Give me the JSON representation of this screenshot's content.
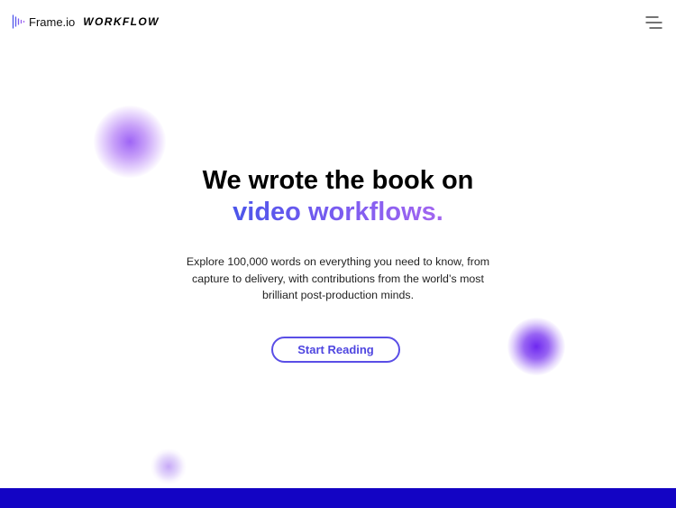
{
  "header": {
    "brand": "Frame.io",
    "product": "WORKFLOW",
    "logo_icon": "soundwave-icon",
    "menu_icon": "hamburger-menu-icon"
  },
  "hero": {
    "title_line1": "We wrote the book on",
    "title_line2": "video workflows.",
    "description": "Explore 100,000 words on everything you need to know, from capture to delivery, with contributions from the world’s most brilliant post-production minds.",
    "cta_label": "Start Reading"
  },
  "colors": {
    "accent_start": "#4b55ea",
    "accent_end": "#a466f0",
    "button_border": "#5a4ee6",
    "footer_band": "#1304c4"
  }
}
